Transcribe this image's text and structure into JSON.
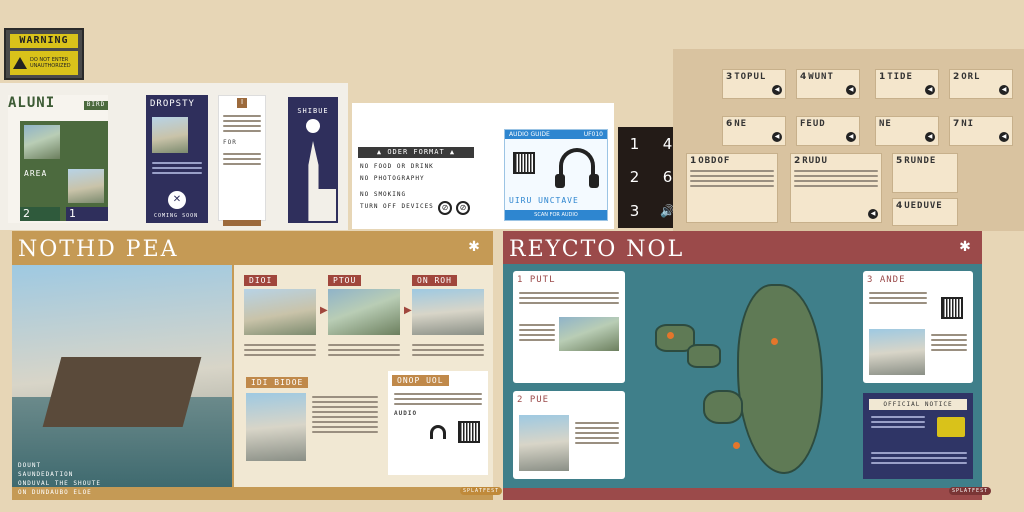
{
  "warning_sign": {
    "title": "WARNING",
    "body": "DO NOT ENTER UNAUTHORIZED"
  },
  "sheet1": {
    "card1_title": "ALUNI",
    "card1_badge": "BIRD",
    "card1_sub": "AREA",
    "card2_title": "DROPSTY",
    "card2_caption": "COMING SOON",
    "card3_title": "FOR",
    "badge_numbers": [
      "2",
      "1"
    ]
  },
  "white_card": {
    "header": "ODER FORMAT",
    "lines": [
      "NO FOOD OR DRINK",
      "NO PHOTOGRAPHY",
      "NO SMOKING",
      "TURN OFF DEVICES"
    ],
    "ticket_label": "AUDIO GUIDE",
    "ticket_code": "UF010",
    "ticket_footer": "SCAN FOR AUDIO"
  },
  "keypad": {
    "keys": [
      "1",
      "4",
      "2",
      "6",
      "3",
      "🔊"
    ]
  },
  "audio_tiles": [
    {
      "num": "3",
      "label": "TOPUL"
    },
    {
      "num": "4",
      "label": "WUNT"
    },
    {
      "num": "1",
      "label": "TIDE"
    },
    {
      "num": "2",
      "label": "ORL"
    },
    {
      "num": "6",
      "label": "NE"
    },
    {
      "num": "",
      "label": "FEUD"
    },
    {
      "num": "",
      "label": "NE"
    },
    {
      "num": "7",
      "label": "NI"
    },
    {
      "num": "1",
      "label": "OBDOF"
    },
    {
      "num": "2",
      "label": "RUDU"
    },
    {
      "num": "5",
      "label": "RUNDE"
    },
    {
      "num": "4",
      "label": "UEDUVE"
    }
  ],
  "poster_left": {
    "title": "NOTHD PEA",
    "steps": [
      "DIOI",
      "PTOU",
      "ON ROH"
    ],
    "section2": "IDI BIDOE",
    "section3": "ONOP UOL",
    "section3_sub": "AUDIO",
    "caption_lines": [
      "DOUNT",
      "SAUNDEDATION",
      "ONDUVAL THE SHOUTE",
      "ON DUNDAUBO ELOE"
    ],
    "logo": "SPLATFEST"
  },
  "poster_right": {
    "title": "REYCTO NOL",
    "point1": "1 PUTL",
    "point2": "2 PUE",
    "point3": "3 ANDE",
    "notice": "OFFICIAL NOTICE",
    "logo": "SPLATFEST"
  },
  "colors": {
    "poster_left": "#c59a55",
    "poster_right": "#9b4a4a",
    "map_water": "#3f7f8a",
    "accent_orange": "#e4762b"
  }
}
